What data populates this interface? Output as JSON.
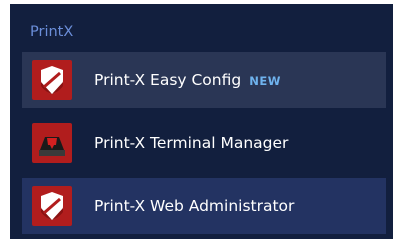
{
  "group": {
    "title": "PrintX"
  },
  "tiles": [
    {
      "label": "Print-X Easy Config",
      "badge": "NEW",
      "icon": "shield-icon"
    },
    {
      "label": "Print-X Terminal Manager",
      "badge": "",
      "icon": "terminal-printer-icon"
    },
    {
      "label": "Print-X Web Administrator",
      "badge": "",
      "icon": "shield-icon"
    }
  ],
  "colors": {
    "background": "#121f3e",
    "tile_selected": "#2a3655",
    "tile_hover": "#233362",
    "group_title": "#6b8ed9",
    "badge": "#6fb3ee",
    "icon_bg": "#b11d1d"
  }
}
